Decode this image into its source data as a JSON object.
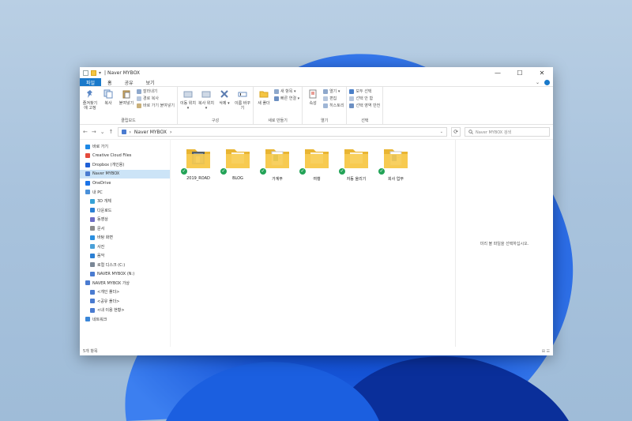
{
  "window": {
    "title": "Naver MYBOX",
    "title_prefix": "| ",
    "controls": {
      "minimize": "—",
      "maximize": "☐",
      "close": "✕"
    }
  },
  "ribbon_tabs": [
    "파일",
    "홈",
    "공유",
    "보기"
  ],
  "ribbon_right": {
    "caret": "⌄"
  },
  "ribbon": {
    "clipboard": {
      "name": "클립보드",
      "pin_label": "즐겨찾기에 고정",
      "copy_label": "복사",
      "paste_label": "붙여넣기",
      "cut_label": "잘라내기",
      "copy_path_label": "경로 복사",
      "paste_shortcut_label": "바로 가기 붙여넣기"
    },
    "organize": {
      "name": "구성",
      "move_label": "이동 위치 ▾",
      "copy_to_label": "복사 위치 ▾",
      "delete_label": "삭제 ▾",
      "rename_label": "이름 바꾸기"
    },
    "new": {
      "name": "새로 만들기",
      "new_folder_label": "새 폴더",
      "new_item_label": "새 항목 ▾",
      "easy_access_label": "빠른 연결 ▾"
    },
    "open": {
      "name": "열기",
      "properties_label": "속성",
      "open_label": "열기 ▾",
      "edit_label": "편집",
      "history_label": "히스토리"
    },
    "select": {
      "name": "선택",
      "select_all_label": "모두 선택",
      "select_none_label": "선택 안 함",
      "invert_label": "선택 영역 반전"
    }
  },
  "address": {
    "path": "Naver MYBOX",
    "separator": "›",
    "back": "←",
    "forward": "→",
    "dropdown": "⌄",
    "up": "↑",
    "refresh": "⟳",
    "search_placeholder": "Naver MYBOX 검색"
  },
  "nav": [
    {
      "label": "바로 가기",
      "icon": "star-icon",
      "color": "#1e88e5",
      "indent": 1,
      "selected": false
    },
    {
      "label": "Creative Cloud Files",
      "icon": "cloud-icon",
      "color": "#e44b3c",
      "indent": 1,
      "selected": false
    },
    {
      "label": "Dropbox (개인용)",
      "icon": "dropbox-icon",
      "color": "#1f5fd6",
      "indent": 1,
      "selected": false
    },
    {
      "label": "Naver MYBOX",
      "icon": "mybox-icon",
      "color": "#4a7bd0",
      "indent": 1,
      "selected": true
    },
    {
      "label": "OneDrive",
      "icon": "onedrive-icon",
      "color": "#1a73e8",
      "indent": 1,
      "selected": false
    },
    {
      "label": "내 PC",
      "icon": "pc-icon",
      "color": "#4a90d9",
      "indent": 1,
      "selected": false
    },
    {
      "label": "3D 개체",
      "icon": "3d-objects-icon",
      "color": "#36a2d6",
      "indent": 2,
      "selected": false
    },
    {
      "label": "다운로드",
      "icon": "download-icon",
      "color": "#2a7fd4",
      "indent": 2,
      "selected": false
    },
    {
      "label": "동영상",
      "icon": "video-icon",
      "color": "#6c6cc4",
      "indent": 2,
      "selected": false
    },
    {
      "label": "문서",
      "icon": "document-icon",
      "color": "#8a8a8a",
      "indent": 2,
      "selected": false
    },
    {
      "label": "바탕 화면",
      "icon": "desktop-icon",
      "color": "#2a8fe0",
      "indent": 2,
      "selected": false
    },
    {
      "label": "사진",
      "icon": "pictures-icon",
      "color": "#4aa0d8",
      "indent": 2,
      "selected": false
    },
    {
      "label": "음악",
      "icon": "music-icon",
      "color": "#2a7fd4",
      "indent": 2,
      "selected": false
    },
    {
      "label": "로컬 디스크 (C:)",
      "icon": "disk-icon",
      "color": "#7a8796",
      "indent": 2,
      "selected": false
    },
    {
      "label": "NAVER MYBOX (N:)",
      "icon": "mybox-drive-icon",
      "color": "#4a7bd0",
      "indent": 2,
      "selected": false
    },
    {
      "label": "NAVER MYBOX 가상",
      "icon": "mybox-virtual-icon",
      "color": "#4a7bd0",
      "indent": 1,
      "selected": false
    },
    {
      "label": "<개인 폴더>",
      "icon": "mybox-folder-icon",
      "color": "#4a7bd0",
      "indent": 2,
      "selected": false
    },
    {
      "label": "<공유 폴더>",
      "icon": "mybox-folder-icon",
      "color": "#4a7bd0",
      "indent": 2,
      "selected": false
    },
    {
      "label": "<내 이용 현황>",
      "icon": "mybox-folder-icon",
      "color": "#4a7bd0",
      "indent": 2,
      "selected": false
    },
    {
      "label": "네트워크",
      "icon": "network-icon",
      "color": "#3a86d8",
      "indent": 1,
      "selected": false
    }
  ],
  "files": [
    {
      "name": "2019_ROAD",
      "kind": "photo",
      "synced": true
    },
    {
      "name": "BLOG",
      "kind": "plain",
      "synced": true
    },
    {
      "name": "가계부",
      "kind": "excel",
      "synced": true
    },
    {
      "name": "여행",
      "kind": "plain",
      "synced": true
    },
    {
      "name": "자동 올리기",
      "kind": "plain",
      "synced": true
    },
    {
      "name": "회사 업무",
      "kind": "word",
      "synced": true
    }
  ],
  "preview_text": "미리 볼 파일을 선택하십시오.",
  "status": {
    "left": "5개 항목",
    "right": "⊞ ☰"
  },
  "colors": {
    "accent": "#1979ca",
    "selection": "#cce4f7",
    "sync": "#22a357",
    "folder": "#f5c542"
  }
}
